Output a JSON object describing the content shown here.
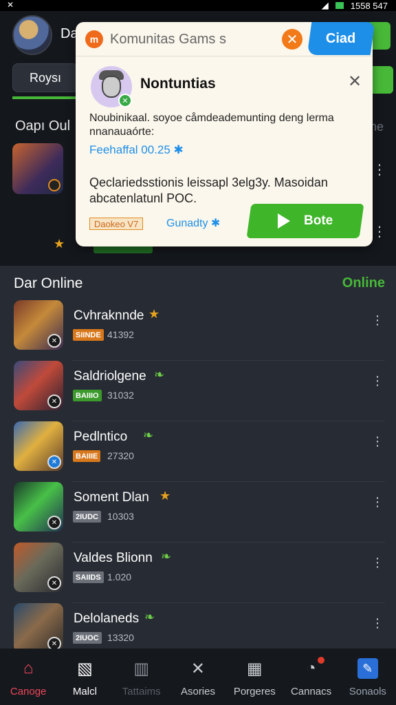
{
  "status_bar": {
    "time": "1558 547"
  },
  "header": {
    "title": "Da",
    "tab_label": "Roysı"
  },
  "bg_section": {
    "title": "Oapı Oul",
    "right_label": "ne"
  },
  "popup": {
    "app_name": "Komunitas Gams s",
    "head_button": "Ciad",
    "user_name": "Nontuntias",
    "message": "Noubinikaal. soyoe cåmdeademunting deng lerma nnanauaórte:",
    "link": "Feehaffal 00.25 ✱",
    "body": "Qeclariedsstionis leissapl 3elg3y. Masoidan abcatenlatunl POC.",
    "tag": "Daokeo V7",
    "tag2": "Gunadty ✱",
    "cta": "Bote"
  },
  "online": {
    "title": "Dar Online",
    "link": "Online",
    "items": [
      {
        "name": "Cvhraknnde",
        "badge": "SIINDE",
        "count": "41392",
        "icon": "star-icon",
        "badge_color": "#d8781c"
      },
      {
        "name": "Saldriolgene",
        "badge": "BAIIIO",
        "count": "31032",
        "icon": "leaf-icon",
        "badge_color": "#3c9a2c"
      },
      {
        "name": "Pedlntico",
        "badge": "BAIIIE",
        "count": "27320",
        "icon": "leaf-icon",
        "badge_color": "#d8781c"
      },
      {
        "name": "Soment Dlan",
        "badge": "2IUDC",
        "count": "10303",
        "icon": "star-icon",
        "badge_color": "#6c7078"
      },
      {
        "name": "Valdes Blionn",
        "badge": "SAIIDS",
        "count": "1.020",
        "icon": "leaf-icon",
        "badge_color": "#6c7078"
      },
      {
        "name": "Delolaneds",
        "badge": "2IUOC",
        "count": "13320",
        "icon": "leaf-icon",
        "badge_color": "#6c7078"
      }
    ]
  },
  "nav": [
    {
      "label": "Canoge",
      "icon": "home-icon",
      "color": "#f0475a"
    },
    {
      "label": "Malcl",
      "icon": "image-icon",
      "color": "#ffffff"
    },
    {
      "label": "Tattaims",
      "icon": "books-icon",
      "color": "#5a5f68"
    },
    {
      "label": "Asories",
      "icon": "cross-icon",
      "color": "#c9ccd1"
    },
    {
      "label": "Porgeres",
      "icon": "grid-icon",
      "color": "#c9ccd1"
    },
    {
      "label": "Cannacs",
      "icon": "gauge-icon",
      "color": "#c9ccd1"
    },
    {
      "label": "Sonaols",
      "icon": "edit-icon",
      "color": "#9aa3b0"
    }
  ]
}
